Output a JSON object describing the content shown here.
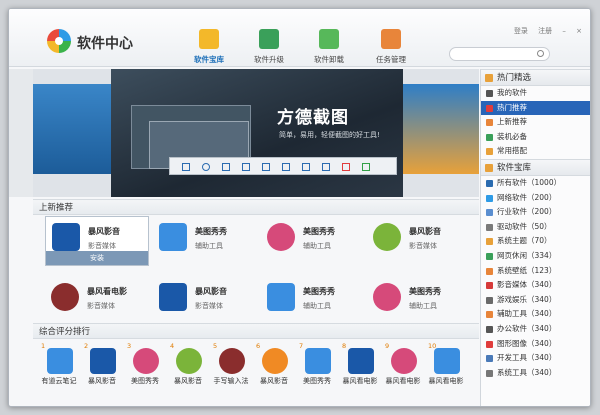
{
  "app": {
    "title": "软件中心"
  },
  "top_links": {
    "login": "登录",
    "register": "注册",
    "minimize": "–",
    "close": "×"
  },
  "nav": [
    {
      "label": "软件宝库",
      "color": "#f3b82a",
      "active": true
    },
    {
      "label": "软件升级",
      "color": "#3aa05a",
      "active": false
    },
    {
      "label": "软件卸载",
      "color": "#57b85a",
      "active": false
    },
    {
      "label": "任务管理",
      "color": "#e8853a",
      "active": false
    }
  ],
  "banner": {
    "title": "方德截图",
    "subtitle": "简单，易用，轻便截图的好工具!"
  },
  "new_section": {
    "title": "上新推荐"
  },
  "new_cards": [
    {
      "name": "暴风影音",
      "category": "影音媒体",
      "icon": "grid-app-icon",
      "color": "#1a58a8",
      "installable": true,
      "install_label": "安装"
    },
    {
      "name": "美图秀秀",
      "category": "辅助工具",
      "icon": "pen-icon",
      "color": "#3a8ee0"
    },
    {
      "name": "美图秀秀",
      "category": "辅助工具",
      "icon": "pink-flower-icon",
      "color": "#d64a7a"
    },
    {
      "name": "暴风影音",
      "category": "影音媒体",
      "icon": "green-ball-icon",
      "color": "#7bb43a"
    },
    {
      "name": "暴风看电影",
      "category": "影音媒体",
      "icon": "film-icon",
      "color": "#8a2d2d"
    },
    {
      "name": "暴风影音",
      "category": "影音媒体",
      "icon": "grid-app-icon",
      "color": "#1a58a8"
    },
    {
      "name": "美图秀秀",
      "category": "辅助工具",
      "icon": "pen-icon",
      "color": "#3a8ee0"
    },
    {
      "name": "美图秀秀",
      "category": "辅助工具",
      "icon": "pink-flower-icon",
      "color": "#d64a7a"
    }
  ],
  "rank_section": {
    "title": "综合评分排行"
  },
  "ranking": [
    {
      "num": "1",
      "name": "有道云笔记",
      "color": "#3a8ee0"
    },
    {
      "num": "2",
      "name": "暴风影音",
      "color": "#1a58a8"
    },
    {
      "num": "3",
      "name": "美图秀秀",
      "color": "#d64a7a"
    },
    {
      "num": "4",
      "name": "暴风影音",
      "color": "#7bb43a"
    },
    {
      "num": "5",
      "name": "手写输入法",
      "color": "#8a2d2d"
    },
    {
      "num": "6",
      "name": "暴风影音",
      "color": "#f08a24"
    },
    {
      "num": "7",
      "name": "美图秀秀",
      "color": "#3a8ee0"
    },
    {
      "num": "8",
      "name": "暴风看电影",
      "color": "#1a58a8"
    },
    {
      "num": "9",
      "name": "暴风看电影",
      "color": "#d64a7a"
    },
    {
      "num": "10",
      "name": "暴风看电影",
      "color": "#3a8ee0"
    }
  ],
  "sidebar": {
    "hot_title": "热门精选",
    "hot_items": [
      {
        "label": "我的软件",
        "color": "#555555",
        "active": false
      },
      {
        "label": "热门推荐",
        "color": "#e03c3c",
        "active": true
      },
      {
        "label": "上新推荐",
        "color": "#e8853a",
        "active": false
      },
      {
        "label": "装机必备",
        "color": "#3aa05a",
        "active": false
      },
      {
        "label": "常用搭配",
        "color": "#e8a13a",
        "active": false
      }
    ],
    "lib_title": "软件宝库",
    "lib_items": [
      {
        "label": "所有软件（1000）",
        "color": "#2a6bb0"
      },
      {
        "label": "网络软件（200）",
        "color": "#2e9be6"
      },
      {
        "label": "行业软件（200）",
        "color": "#5a8ed0"
      },
      {
        "label": "驱动软件（50）",
        "color": "#7a7a7a"
      },
      {
        "label": "系统主题（70）",
        "color": "#e8a13a"
      },
      {
        "label": "网页休闲（334）",
        "color": "#3aa05a"
      },
      {
        "label": "系统壁纸（123）",
        "color": "#e8853a"
      },
      {
        "label": "影音媒体（340）",
        "color": "#d63a3a"
      },
      {
        "label": "游戏娱乐（340）",
        "color": "#6a6a6a"
      },
      {
        "label": "辅助工具（340）",
        "color": "#e8853a"
      },
      {
        "label": "办公软件（340）",
        "color": "#555555"
      },
      {
        "label": "图形图像（340）",
        "color": "#e03c3c"
      },
      {
        "label": "开发工具（340）",
        "color": "#4a7ab8"
      },
      {
        "label": "系统工具（340）",
        "color": "#777777"
      }
    ]
  }
}
